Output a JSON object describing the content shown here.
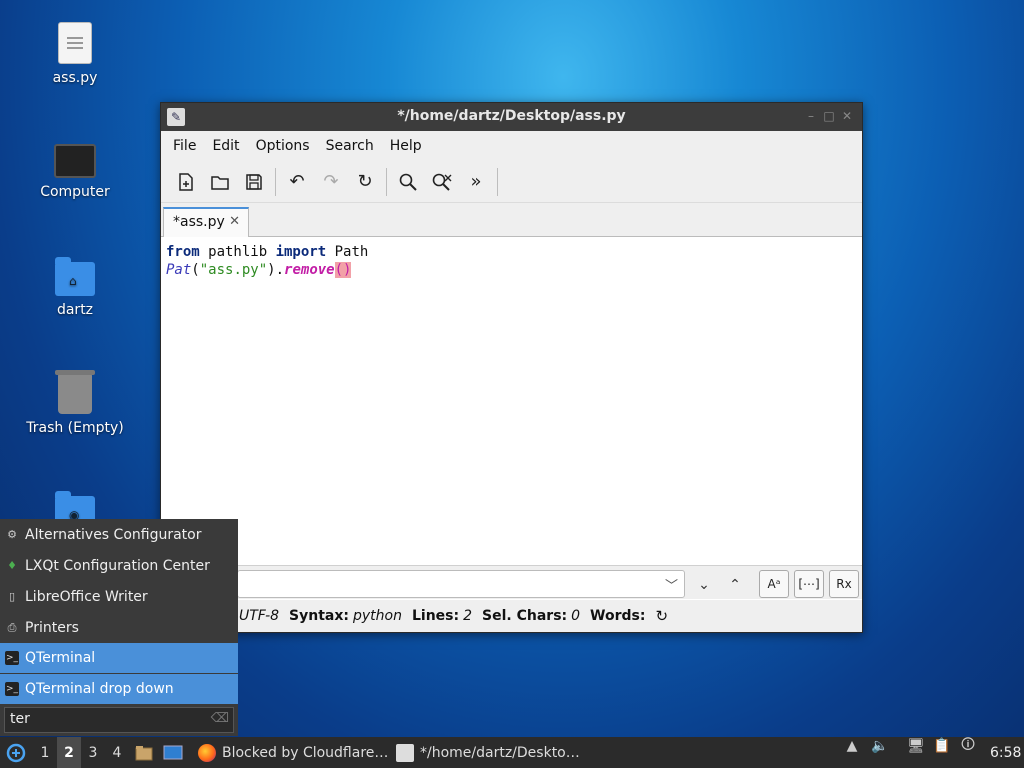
{
  "desktop": {
    "icons": [
      {
        "label": "ass.py"
      },
      {
        "label": "Computer"
      },
      {
        "label": "dartz"
      },
      {
        "label": "Trash (Empty)"
      }
    ]
  },
  "window": {
    "title": "*/home/dartz/Desktop/ass.py",
    "menu": [
      "File",
      "Edit",
      "Options",
      "Search",
      "Help"
    ],
    "toolbar": [
      "new-file-icon",
      "open-folder-icon",
      "save-icon",
      "undo-icon",
      "redo-icon",
      "reload-icon",
      "find-icon",
      "find-replace-icon",
      "more-icon"
    ],
    "tab": {
      "label": "*ass.py",
      "close": "✕"
    },
    "code": {
      "line1": {
        "kw1": "from",
        "mod": " pathlib ",
        "kw2": "import",
        "name": " Path"
      },
      "line2": {
        "cls": "Pat",
        "open": "(",
        "str": "\"ass.py\"",
        "close": ").",
        "method": "remove",
        "parens": "()"
      }
    },
    "findbar": {
      "value": ""
    },
    "status": {
      "encoding": "UTF-8",
      "syntax_label": "Syntax:",
      "syntax": "python",
      "lines_label": "Lines:",
      "lines": "2",
      "selchars_label": "Sel. Chars:",
      "selchars": "0",
      "words_label": "Words:"
    }
  },
  "startmenu": {
    "items": [
      {
        "label": "Alternatives Configurator",
        "selected": false
      },
      {
        "label": "LXQt Configuration Center",
        "selected": false
      },
      {
        "label": "LibreOffice Writer",
        "selected": false
      },
      {
        "label": "Printers",
        "selected": false
      },
      {
        "label": "QTerminal",
        "selected": true
      },
      {
        "label": "QTerminal drop down",
        "selected": true
      }
    ],
    "search_value": "ter"
  },
  "taskbar": {
    "workspaces": [
      "1",
      "2",
      "3",
      "4"
    ],
    "active_workspace": "2",
    "tasks": [
      {
        "label": "Blocked by Cloudflare…"
      },
      {
        "label": "*/home/dartz/Deskto…"
      }
    ],
    "clock": "6:58"
  }
}
